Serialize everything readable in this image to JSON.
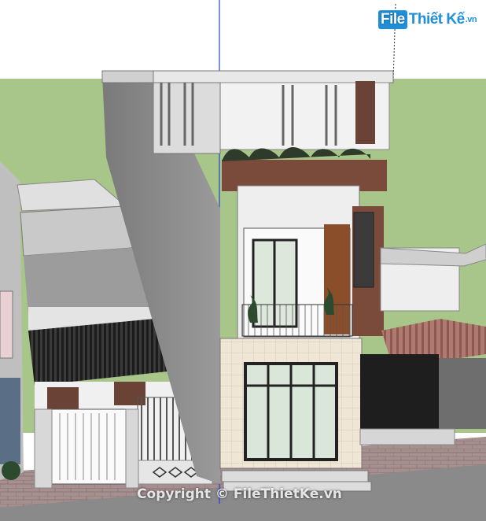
{
  "watermark_logo": {
    "file_label": "File",
    "name_label": "Thiết Kế",
    "suffix_label": ".vn"
  },
  "copyright_text": "Copyright © FileThietKe.vn",
  "colors": {
    "sky": "#ffffff",
    "grass": "#a9c68a",
    "road": "#8a8a8a",
    "sidewalk": "#a58f8f",
    "wall_grey": "#8c8c8c",
    "wall_white": "#ececec",
    "brown_accent": "#7a4a3a",
    "tile_beige": "#efe6d6",
    "plant_green": "#2e4a2e",
    "logo_blue": "#1f8fd9"
  },
  "icons": [
    "copyright-symbol"
  ]
}
